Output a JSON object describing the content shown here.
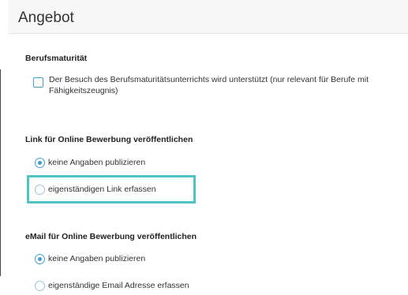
{
  "header": {
    "title": "Angebot"
  },
  "berufsmaturitaet": {
    "title": "Berufsmaturität",
    "checkbox_label": "Der Besuch des Berufsmaturitätsunterrichts wird unterstützt (nur relevant für Berufe mit Fähigkeitszeugnis)",
    "checked": false
  },
  "link_section": {
    "title": "Link für Online Bewerbung veröffentlichen",
    "options": [
      {
        "label": "keine Angaben publizieren",
        "checked": true
      },
      {
        "label": "eigenständigen Link erfassen",
        "checked": false
      }
    ]
  },
  "email_section": {
    "title": "eMail für Online Bewerbung veröffentlichen",
    "options": [
      {
        "label": "keine Angaben publizieren",
        "checked": true
      },
      {
        "label": "eigenständige Email Adresse erfassen",
        "checked": false
      }
    ]
  },
  "colors": {
    "accent": "#3ea0cf",
    "highlight": "#4ec3c3",
    "header_bg": "#f7f7f7"
  }
}
